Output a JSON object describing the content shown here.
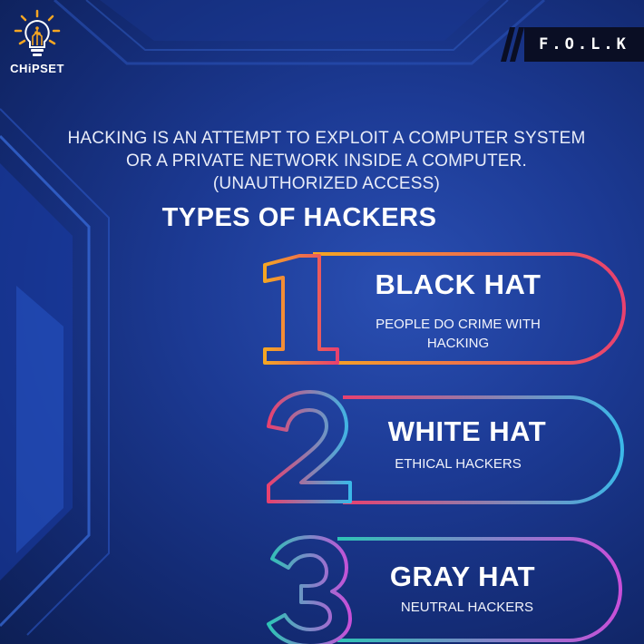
{
  "brand": {
    "logo_text": "CHiPSET",
    "badge_text": "F.O.L.K"
  },
  "intro": {
    "lines": [
      "HACKING IS AN ATTEMPT TO EXPLOIT A COMPUTER SYSTEM",
      "OR A PRIVATE NETWORK INSIDE A COMPUTER.",
      "(UNAUTHORIZED ACCESS)"
    ]
  },
  "section_title": "TYPES OF HACKERS",
  "hacker_types": [
    {
      "number": "1",
      "title": "BLACK HAT",
      "desc_lines": [
        "PEOPLE DO CRIME WITH",
        "HACKING"
      ],
      "colors": [
        "#f5a623",
        "#e8416f"
      ]
    },
    {
      "number": "2",
      "title": "WHITE HAT",
      "desc_lines": [
        "ETHICAL HACKERS"
      ],
      "colors": [
        "#e8416f",
        "#3bb8e8"
      ]
    },
    {
      "number": "3",
      "title": "GRAY HAT",
      "desc_lines": [
        "NEUTRAL HACKERS"
      ],
      "colors": [
        "#2ec4b6",
        "#c84fd8"
      ]
    }
  ]
}
